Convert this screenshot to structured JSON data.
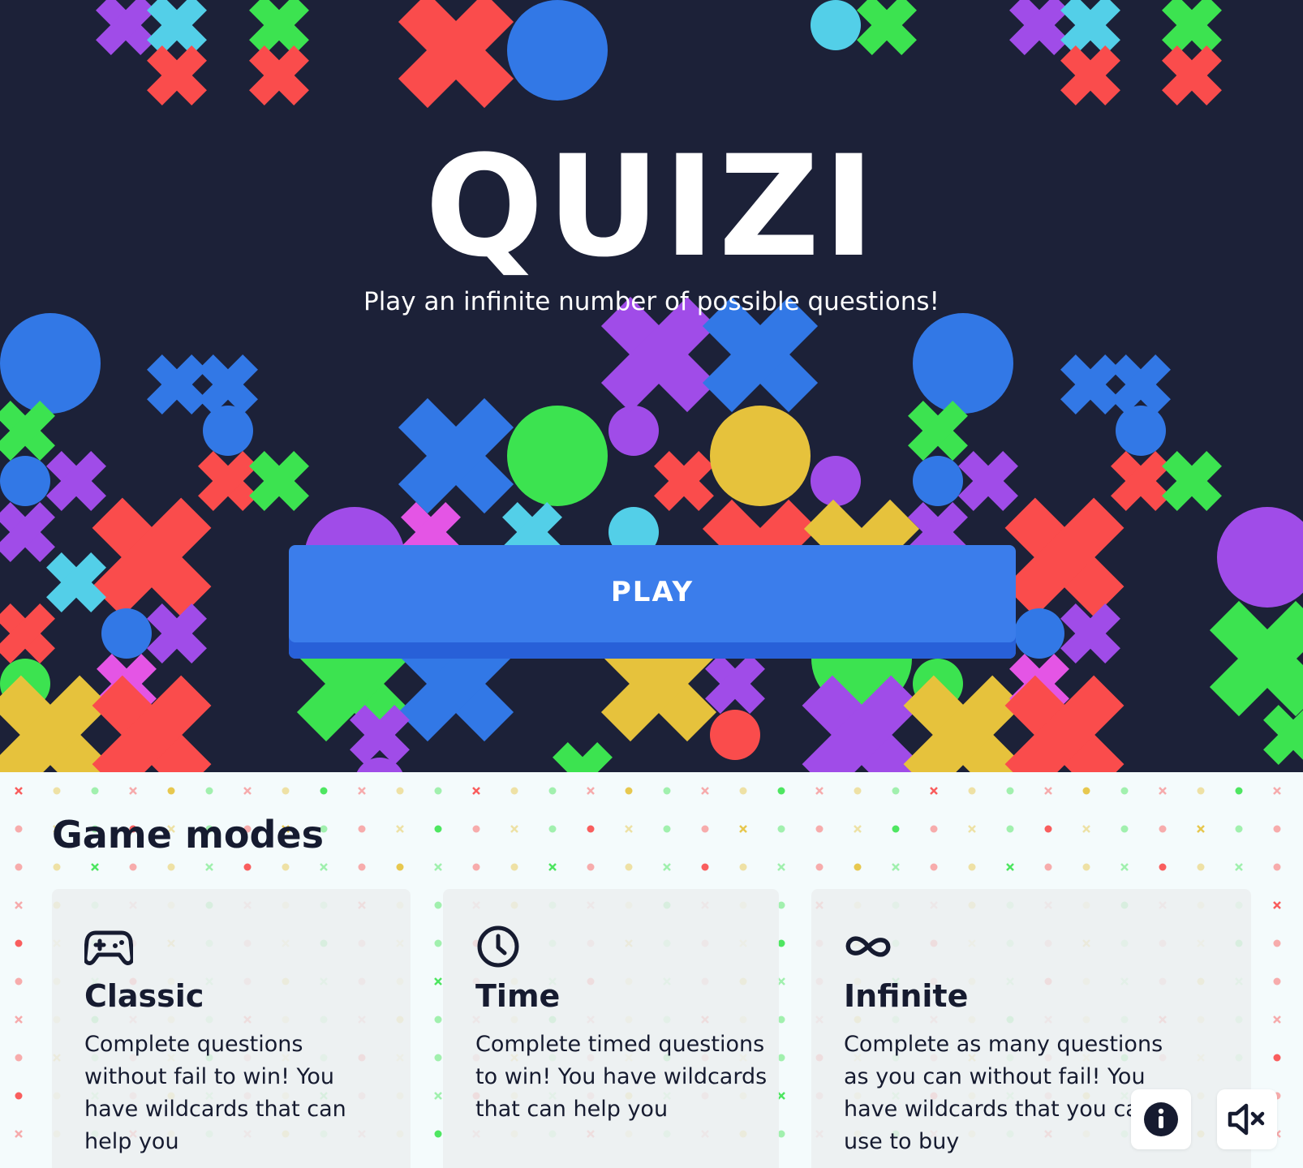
{
  "hero": {
    "title": "QUIZI",
    "subtitle": "Play an infinite number of possible questions!",
    "play_label": "PLAY"
  },
  "game_modes": {
    "title": "Game modes",
    "modes": [
      {
        "icon": "gamepad-icon",
        "title": "Classic",
        "description": "Complete questions without fail to win! You have wildcards that can help you"
      },
      {
        "icon": "clock-icon",
        "title": "Time",
        "description": "Complete timed questions to win! You have wildcards that can help you"
      },
      {
        "icon": "infinity-icon",
        "title": "Infinite",
        "description": "Complete as many questions as you can without fail! You have wildcards that you can use to buy"
      }
    ]
  },
  "controls": {
    "info_icon": "info-icon",
    "sound_icon": "volume-muted-icon"
  },
  "colors": {
    "background": "#1c2138",
    "play_button": "#3b7deb",
    "lower_background": "#f4fbfc",
    "text_dark": "#161b30",
    "shape_palette": [
      "#fa4c4c",
      "#3278e6",
      "#3ce350",
      "#a04ce8",
      "#53cfe8",
      "#e6c23c",
      "#e455e5"
    ]
  }
}
